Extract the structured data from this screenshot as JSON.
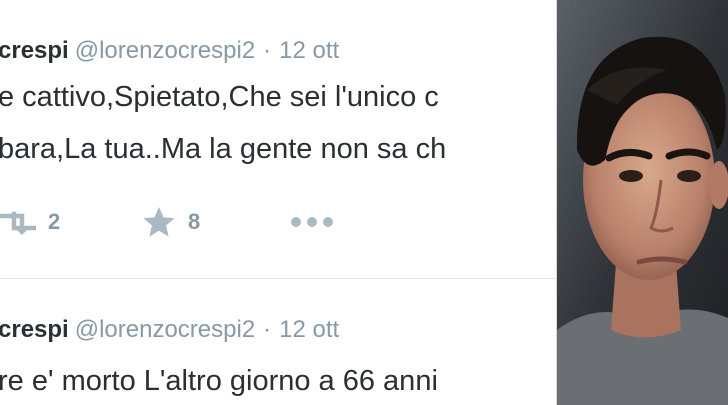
{
  "tweets": [
    {
      "name": "crespi",
      "handle": "@lorenzocrespi2",
      "sep": "·",
      "date": "12 ott",
      "line1": "e cattivo,Spietato,Che sei l'unico c",
      "line2": "bara,La tua..Ma la gente non sa ch",
      "retweet_count": "2",
      "favorite_count": "8"
    },
    {
      "name": "crespi",
      "handle": "@lorenzocrespi2",
      "sep": "·",
      "date": "12 ott",
      "line1": "re e' morto L'altro giorno a 66 anni"
    }
  ],
  "colors": {
    "name": "#292f33",
    "meta": "#8899a6",
    "icon": "#aab8c2"
  },
  "icons": [
    "retweet-icon",
    "star-icon",
    "more-icon"
  ],
  "photo": "portrait of a young man with dark hair"
}
